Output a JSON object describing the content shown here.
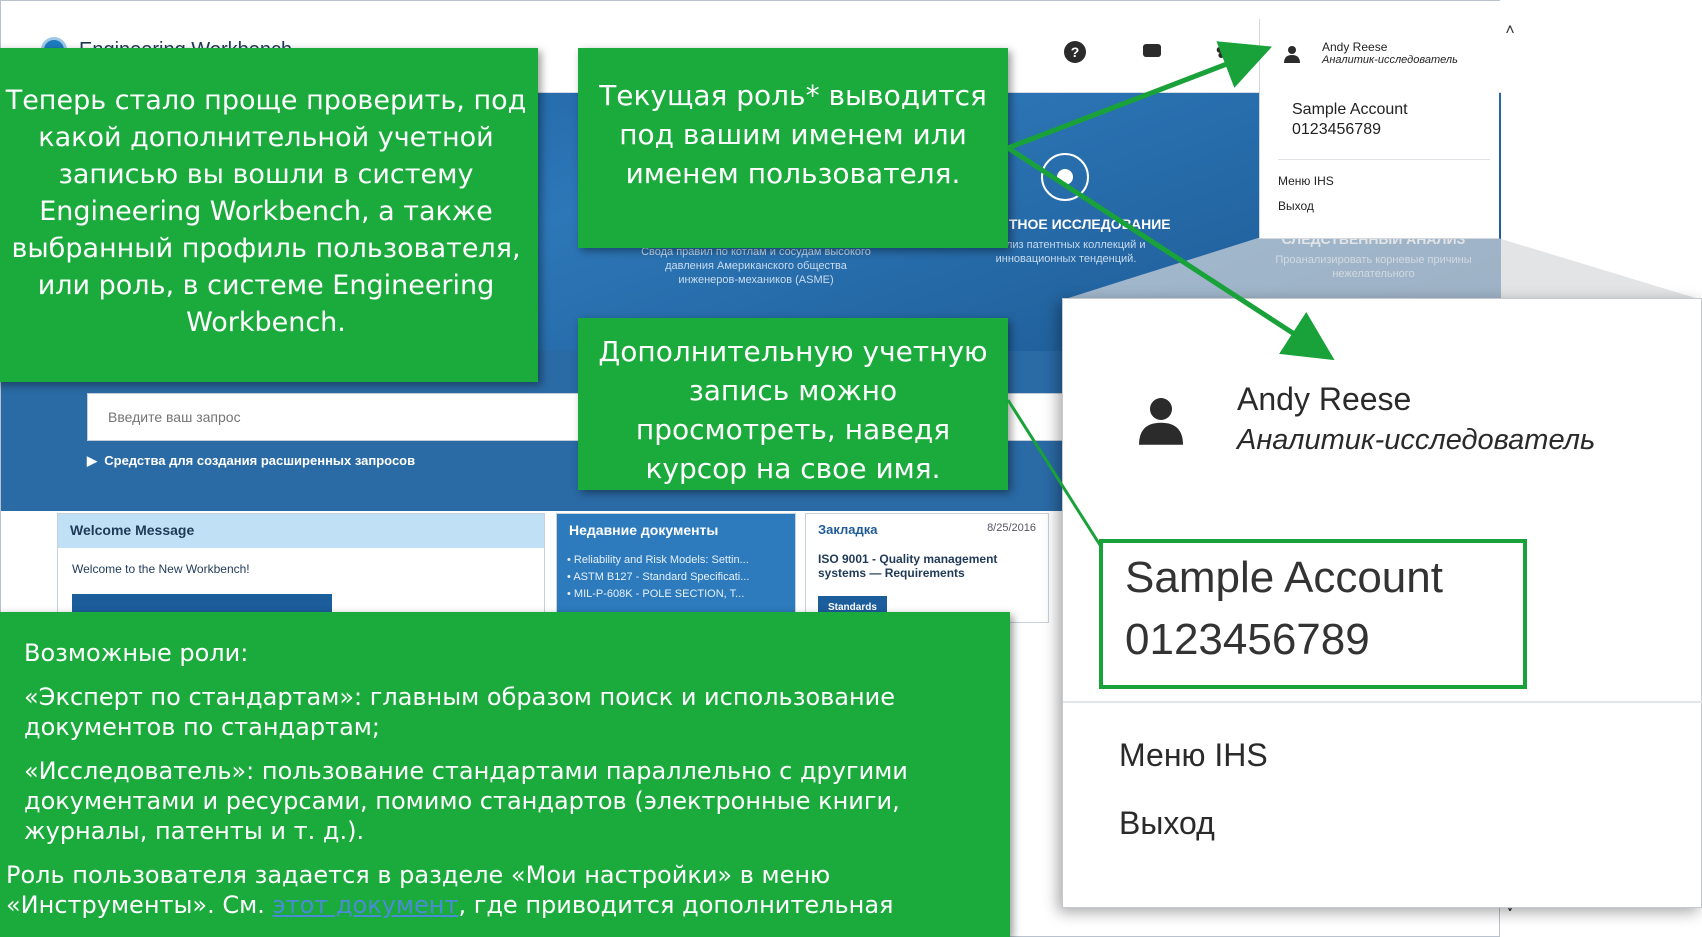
{
  "app": {
    "title": "Engineering Workbench",
    "user_name": "Andy Reese",
    "user_role": "Аналитик-исследователь",
    "account_name": "Sample Account",
    "account_number": "0123456789",
    "menu_ihs": "Меню IHS",
    "logout": "Выход"
  },
  "modules": [
    {
      "title": "",
      "desc": "Свода правил по котлам и сосудам высокого давления Американского общества инженеров-механиков (ASME)"
    },
    {
      "title": "ПАТЕНТНОЕ ИССЛЕДОВАНИЕ",
      "desc": "Анализ патентных коллекций и инновационных тенденций."
    },
    {
      "title": "СЛЕДСТВЕННЫЙ АНАЛИЗ",
      "desc": "Проанализировать корневые причины нежелательного"
    }
  ],
  "search": {
    "placeholder": "Введите ваш запрос",
    "advanced_label": "Средства для создания расширенных запросов"
  },
  "panels": {
    "welcome": {
      "title": "Welcome Message",
      "text": "Welcome to the New Workbench!"
    },
    "recent": {
      "title": "Недавние документы",
      "items": [
        "Reliability and Risk Models: Settin...",
        "ASTM B127 - Standard Specificati...",
        "MIL-P-608K - POLE SECTION, T..."
      ]
    },
    "bookmark": {
      "title": "Закладка",
      "date": "8/25/2016",
      "doc_title": "ISO 9001 - Quality management systems — Requirements",
      "badge": "Standards"
    }
  },
  "callouts": {
    "c1": "Теперь стало проще проверить, под какой дополнительной учетной записью вы вошли в систему Engineering Workbench, а также выбранный профиль пользователя, или роль, в системе Engineering Workbench.",
    "c2": "Текущая роль* выводится под вашим именем или именем пользователя.",
    "c3": "Дополнительную учетную запись можно просмотреть, наведя курсор на свое имя.",
    "c4_title": "Возможные роли:",
    "c4_role1": "«Эксперт по стандартам»: главным образом поиск и использование документов по стандартам;",
    "c4_role2": "«Исследователь»: пользование стандартами параллельно с другими документами и ресурсами, помимо стандартов (электронные книги, журналы, патенты и т. д.).",
    "c4_note_before": "Роль пользователя задается в разделе «Мои настройки» в меню «Инструменты». См. ",
    "c4_link": "этот документ",
    "c4_note_after": ", где приводится дополнительная"
  },
  "colors": {
    "callout_green": "#1aab3c",
    "arrow_green": "#19a23a",
    "hero_blue": "#1c5d9c"
  }
}
